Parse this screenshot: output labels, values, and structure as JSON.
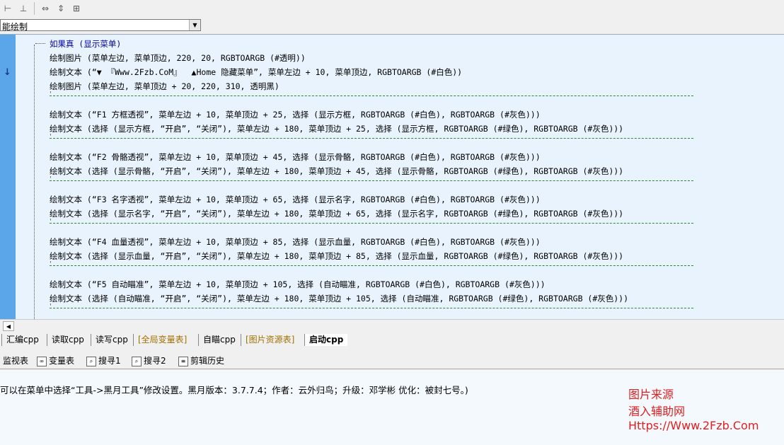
{
  "toolbar": {
    "icons": [
      "align-left-icon",
      "align-justify-icon",
      "width-icon",
      "height-icon",
      "size-icon"
    ],
    "dropdown_value": "能绘制"
  },
  "code": {
    "if_head": "如果真 (显示菜单)",
    "lines": [
      "绘制图片 (菜单左边, 菜单顶边, 220, 20, RGBTOARGB (#透明))",
      "绘制文本 (“▼ 『Www.2Fzb.CoM』  ▲Home 隐藏菜单”, 菜单左边 + 10, 菜单顶边, RGBTOARGB (#白色))",
      "绘制图片 (菜单左边, 菜单顶边 + 20, 220, 310, 透明黑)",
      "绘制文本 (“F1 方框透视”, 菜单左边 + 10, 菜单顶边 + 25, 选择 (显示方框, RGBTOARGB (#白色), RGBTOARGB (#灰色)))",
      "绘制文本 (选择 (显示方框, “开启”, “关闭”), 菜单左边 + 180, 菜单顶边 + 25, 选择 (显示方框, RGBTOARGB (#绿色), RGBTOARGB (#灰色)))",
      "绘制文本 (“F2 骨骼透视”, 菜单左边 + 10, 菜单顶边 + 45, 选择 (显示骨骼, RGBTOARGB (#白色), RGBTOARGB (#灰色)))",
      "绘制文本 (选择 (显示骨骼, “开启”, “关闭”), 菜单左边 + 180, 菜单顶边 + 45, 选择 (显示骨骼, RGBTOARGB (#绿色), RGBTOARGB (#灰色)))",
      "绘制文本 (“F3 名字透视”, 菜单左边 + 10, 菜单顶边 + 65, 选择 (显示名字, RGBTOARGB (#白色), RGBTOARGB (#灰色)))",
      "绘制文本 (选择 (显示名字, “开启”, “关闭”), 菜单左边 + 180, 菜单顶边 + 65, 选择 (显示名字, RGBTOARGB (#绿色), RGBTOARGB (#灰色)))",
      "绘制文本 (“F4 血量透视”, 菜单左边 + 10, 菜单顶边 + 85, 选择 (显示血量, RGBTOARGB (#白色), RGBTOARGB (#灰色)))",
      "绘制文本 (选择 (显示血量, “开启”, “关闭”), 菜单左边 + 180, 菜单顶边 + 85, 选择 (显示血量, RGBTOARGB (#绿色), RGBTOARGB (#灰色)))",
      "绘制文本 (“F5 自动瞄准”, 菜单左边 + 10, 菜单顶边 + 105, 选择 (自动瞄准, RGBTOARGB (#白色), RGBTOARGB (#灰色)))",
      "绘制文本 (选择 (自动瞄准, “开启”, “关闭”), 菜单左边 + 180, 菜单顶边 + 105, 选择 (自动瞄准, RGBTOARGB (#绿色), RGBTOARGB (#灰色)))"
    ]
  },
  "tabs": [
    "汇编cpp",
    "读取cpp",
    "读写cpp",
    "[全局变量表]",
    "自瞄cpp",
    "[图片资源表]",
    "启动cpp"
  ],
  "panel_tabs": [
    "监视表",
    "变量表",
    "搜寻1",
    "搜寻2",
    "剪辑历史"
  ],
  "output": {
    "message": "可以在菜单中选择“工具->黑月工具”修改设置。黑月版本：3.7.7.4；作者：云外归鸟；升级：邓学彬 优化：被封七号。)"
  },
  "watermark": [
    "图片来源",
    "酒入辅助网",
    "Https://Www.2Fzb.Com"
  ]
}
